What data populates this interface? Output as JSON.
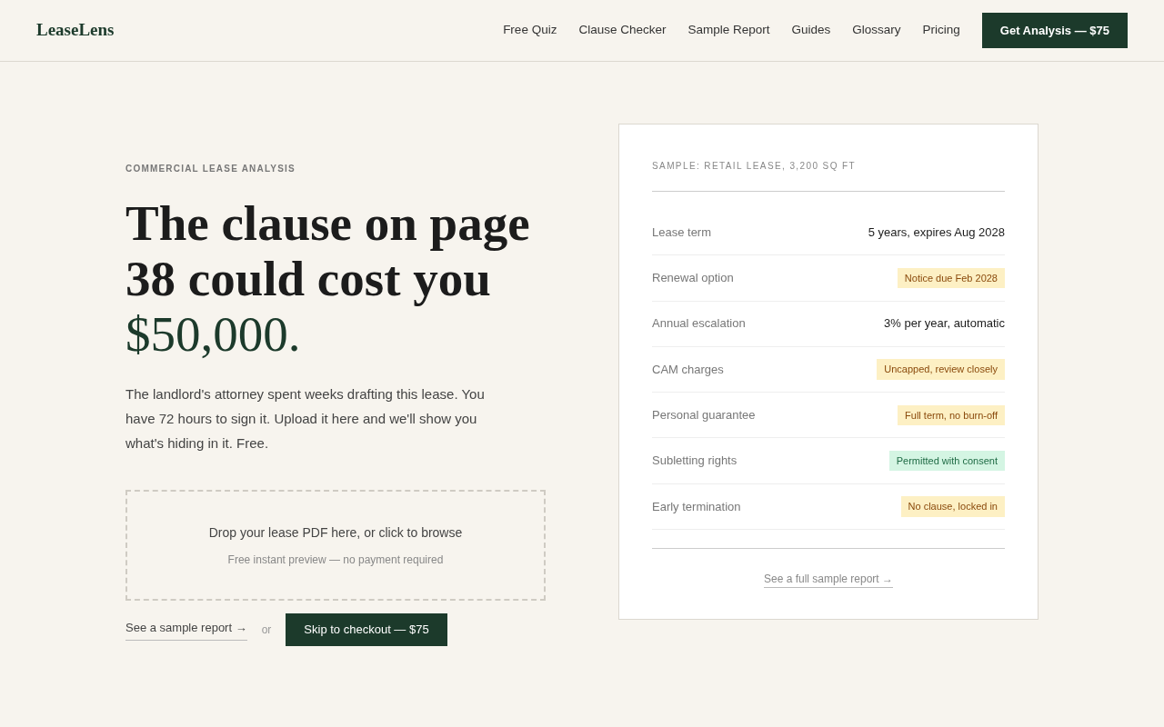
{
  "brand": "LeaseLens",
  "nav": [
    "Free Quiz",
    "Clause Checker",
    "Sample Report",
    "Guides",
    "Glossary",
    "Pricing"
  ],
  "nav_cta": "Get Analysis — $75",
  "eyebrow": "COMMERCIAL LEASE ANALYSIS",
  "headline": {
    "lead": "The clause on page 38 could cost you",
    "accent": "$50,000."
  },
  "intro": "The landlord's attorney spent weeks drafting this lease. You have 72 hours to sign it. Upload it here and we'll show you what's hiding in it. Free.",
  "dropzone": {
    "title": "Drop your lease PDF here, or click to browse",
    "note": "Free instant preview — no payment required"
  },
  "sample_link": "See a sample report →",
  "or": "or",
  "checkout": "Skip to checkout — $75",
  "card": {
    "caption": "SAMPLE: RETAIL LEASE, 3,200 SQ FT",
    "rows": [
      {
        "label": "Lease term",
        "value": "5 years, expires Aug 2028",
        "kind": "plain"
      },
      {
        "label": "Renewal option",
        "value": "Notice due Feb 2028",
        "kind": "warn"
      },
      {
        "label": "Annual escalation",
        "value": "3% per year, automatic",
        "kind": "plain"
      },
      {
        "label": "CAM charges",
        "value": "Uncapped, review closely",
        "kind": "warn"
      },
      {
        "label": "Personal guarantee",
        "value": "Full term, no burn-off",
        "kind": "warn"
      },
      {
        "label": "Subletting rights",
        "value": "Permitted with consent",
        "kind": "ok"
      },
      {
        "label": "Early termination",
        "value": "No clause, locked in",
        "kind": "warn"
      }
    ],
    "link": "See a full sample report →"
  }
}
